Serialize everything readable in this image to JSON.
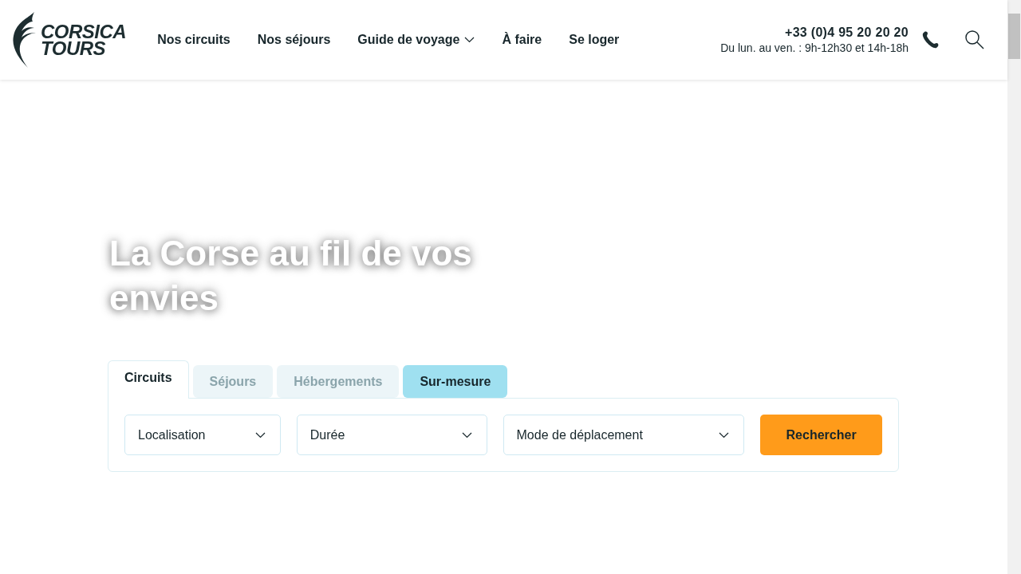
{
  "logo": {
    "line_1": "CORSICA",
    "line_2": "TOURS"
  },
  "nav": [
    {
      "label": "Nos circuits",
      "dropdown": false
    },
    {
      "label": "Nos séjours",
      "dropdown": false
    },
    {
      "label": "Guide de voyage",
      "dropdown": true
    },
    {
      "label": "À faire",
      "dropdown": false
    },
    {
      "label": "Se loger",
      "dropdown": false
    }
  ],
  "contact": {
    "phone": "+33 (0)4 95 20 20 20",
    "hours": "Du lun. au ven. : 9h-12h30 et 14h-18h"
  },
  "hero": {
    "title": "La Corse au fil de vos envies"
  },
  "tabs": [
    {
      "label": "Circuits",
      "selected": true,
      "kind": "standard"
    },
    {
      "label": "Séjours",
      "selected": false,
      "kind": "standard"
    },
    {
      "label": "Hébergements",
      "selected": false,
      "kind": "standard"
    },
    {
      "label": "Sur-mesure",
      "selected": false,
      "kind": "featured"
    }
  ],
  "filters": [
    {
      "placeholder": "Localisation"
    },
    {
      "placeholder": "Durée"
    },
    {
      "placeholder": "Mode de déplacement"
    }
  ],
  "search_button": "Rechercher"
}
